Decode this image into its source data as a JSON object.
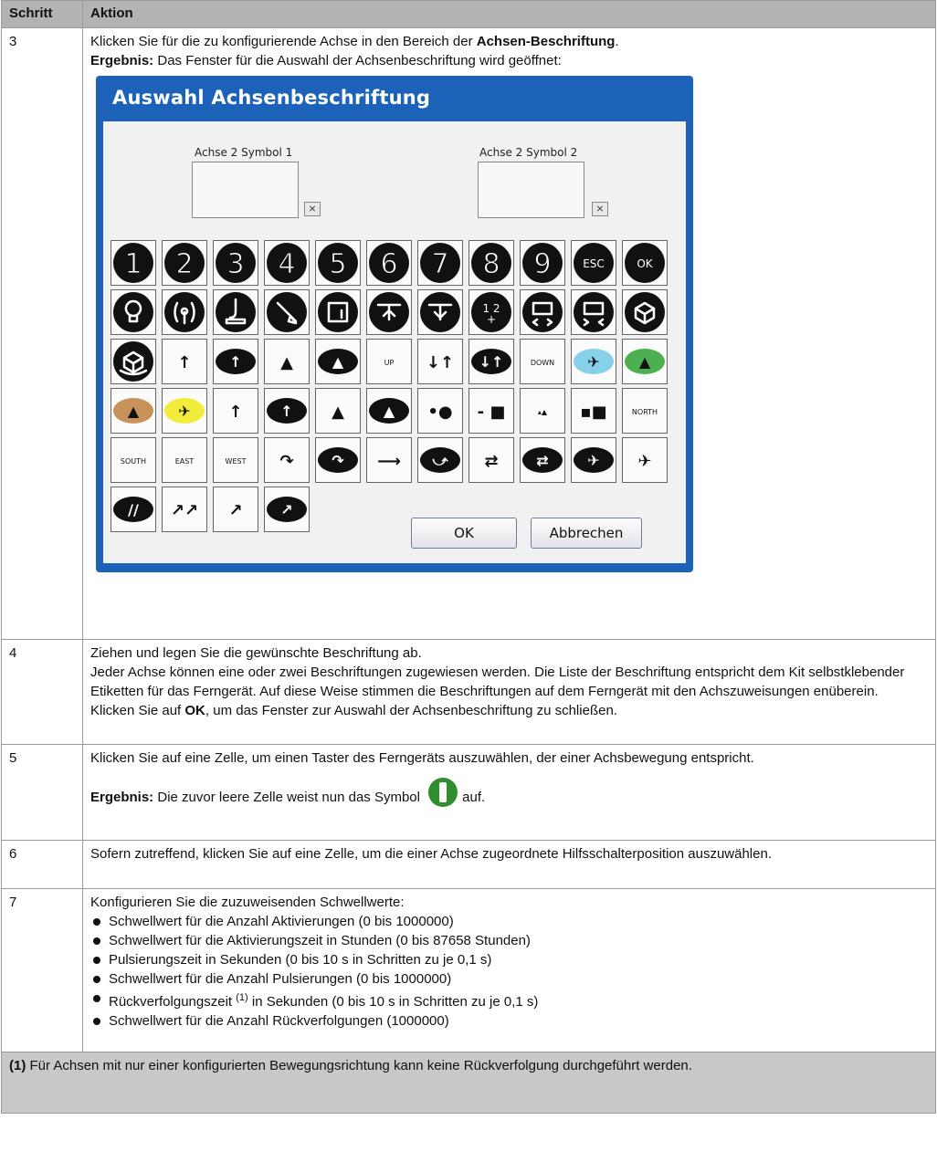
{
  "header": {
    "col1": "Schritt",
    "col2": "Aktion"
  },
  "row3": {
    "step": "3",
    "line1_pre": "Klicken Sie für die zu konfigurierende Achse in den Bereich der ",
    "line1_bold": "Achsen-Beschriftung",
    "line1_post": ".",
    "line2_bold": "Ergebnis:",
    "line2_text": " Das Fenster für die Auswahl der Achsenbeschriftung wird geöffnet:"
  },
  "dialog": {
    "title": "Auswahl Achsenbeschriftung",
    "symbol1_label": "Achse 2 Symbol 1",
    "symbol2_label": "Achse 2 Symbol 2",
    "ok_label": "OK",
    "cancel_label": "Abbrechen",
    "tiles": [
      {
        "t": "num",
        "v": "1"
      },
      {
        "t": "num",
        "v": "2"
      },
      {
        "t": "num",
        "v": "3"
      },
      {
        "t": "num",
        "v": "4"
      },
      {
        "t": "num",
        "v": "5"
      },
      {
        "t": "num",
        "v": "6"
      },
      {
        "t": "num",
        "v": "7"
      },
      {
        "t": "num",
        "v": "8"
      },
      {
        "t": "num",
        "v": "9"
      },
      {
        "t": "numsm",
        "v": "ESC"
      },
      {
        "t": "numsm",
        "v": "OK"
      },
      {
        "t": "icon",
        "v": "lamp"
      },
      {
        "t": "icon",
        "v": "radio"
      },
      {
        "t": "icon",
        "v": "hook"
      },
      {
        "t": "icon",
        "v": "tilt"
      },
      {
        "t": "icon",
        "v": "door"
      },
      {
        "t": "icon",
        "v": "clamp-up"
      },
      {
        "t": "icon",
        "v": "clamp-down"
      },
      {
        "t": "numsm",
        "v": "1 2\n+"
      },
      {
        "t": "icon",
        "v": "open-h"
      },
      {
        "t": "icon",
        "v": "close-h"
      },
      {
        "t": "icon",
        "v": "rotate"
      },
      {
        "t": "icon",
        "v": "rotate2"
      },
      {
        "t": "text",
        "v": "↑"
      },
      {
        "t": "blob",
        "v": "↑"
      },
      {
        "t": "text",
        "v": "▲"
      },
      {
        "t": "blob",
        "v": "▲"
      },
      {
        "t": "text",
        "v": "UP",
        "sm": true
      },
      {
        "t": "text",
        "v": "↓↑"
      },
      {
        "t": "blob",
        "v": "↓↑"
      },
      {
        "t": "text",
        "v": "DOWN",
        "sm": true
      },
      {
        "t": "color",
        "v": "✈",
        "c": "#86d0e8"
      },
      {
        "t": "color",
        "v": "▲",
        "c": "#4caf50"
      },
      {
        "t": "color",
        "v": "▲",
        "c": "#c8935a"
      },
      {
        "t": "color",
        "v": "✈",
        "c": "#f2ec3a"
      },
      {
        "t": "text",
        "v": "↑"
      },
      {
        "t": "blob",
        "v": "↑"
      },
      {
        "t": "text",
        "v": "▲"
      },
      {
        "t": "blob",
        "v": "▲"
      },
      {
        "t": "text",
        "v": "•●"
      },
      {
        "t": "text",
        "v": "- ■"
      },
      {
        "t": "text",
        "v": "▴▲",
        "sm": true
      },
      {
        "t": "text",
        "v": "▪■"
      },
      {
        "t": "text",
        "v": "NORTH",
        "sm": true
      },
      {
        "t": "text",
        "v": "SOUTH",
        "sm": true
      },
      {
        "t": "text",
        "v": "EAST",
        "sm": true
      },
      {
        "t": "text",
        "v": "WEST",
        "sm": true
      },
      {
        "t": "text",
        "v": "↷"
      },
      {
        "t": "blob",
        "v": "↷"
      },
      {
        "t": "text",
        "v": "⟶"
      },
      {
        "t": "blob",
        "v": "⤻"
      },
      {
        "t": "text",
        "v": "⇄"
      },
      {
        "t": "blob",
        "v": "⇄"
      },
      {
        "t": "blob",
        "v": "✈"
      },
      {
        "t": "text",
        "v": "✈"
      },
      {
        "t": "blob",
        "v": "//"
      },
      {
        "t": "text",
        "v": "↗↗"
      },
      {
        "t": "text",
        "v": "↗"
      },
      {
        "t": "blob",
        "v": "↗"
      }
    ]
  },
  "row4": {
    "step": "4",
    "line1": "Ziehen und legen Sie die gewünschte Beschriftung ab.",
    "line2": "Jeder Achse können eine oder zwei Beschriftungen zugewiesen werden. Die Liste der Beschriftung entspricht dem Kit selbstklebender Etiketten für das Ferngerät. Auf diese Weise stimmen die Beschriftungen auf dem Ferngerät mit den Achszuweisungen enüberein.",
    "line3_pre": "Klicken Sie auf ",
    "line3_bold": "OK",
    "line3_post": ", um das Fenster zur Auswahl der Achsenbeschriftung zu schließen."
  },
  "row5": {
    "step": "5",
    "line1": "Klicken Sie auf eine Zelle, um einen Taster des Ferngeräts auszuwählen, der einer Achsbewegung entspricht.",
    "line2_bold": "Ergebnis:",
    "line2_text": " Die zuvor leere Zelle weist nun das Symbol",
    "line2_post": "auf."
  },
  "row6": {
    "step": "6",
    "text": "Sofern zutreffend, klicken Sie auf eine Zelle, um die einer Achse zugeordnete Hilfsschalterposition auszuwählen."
  },
  "row7": {
    "step": "7",
    "intro": "Konfigurieren Sie die zuzuweisenden Schwellwerte:",
    "bullets": [
      "Schwellwert für die Anzahl Aktivierungen (0 bis 1000000)",
      "Schwellwert für die Aktivierungszeit in Stunden (0 bis 87658 Stunden)",
      "Pulsierungszeit in Sekunden (0 bis 10 s in Schritten zu je 0,1 s)",
      "Schwellwert für die Anzahl Pulsierungen (0 bis 1000000)"
    ],
    "bullet5_pre": "Rückverfolgungszeit ",
    "bullet5_sup": "(1)",
    "bullet5_post": " in Sekunden (0 bis 10 s in Schritten zu je 0,1 s)",
    "bullet6": "Schwellwert für die Anzahl Rückverfolgungen (1000000)"
  },
  "footnote": {
    "mark": "(1)",
    "text": " Für Achsen mit nur einer konfigurierten Bewegungsrichtung kann keine Rückverfolgung durchgeführt werden."
  }
}
